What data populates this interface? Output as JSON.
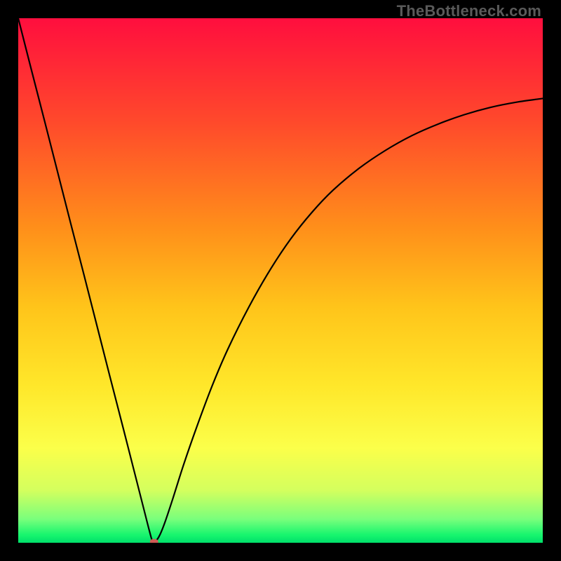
{
  "watermark": "TheBottleneck.com",
  "chart_data": {
    "type": "line",
    "title": "",
    "xlabel": "",
    "ylabel": "",
    "xlim": [
      0,
      100
    ],
    "ylim": [
      0,
      100
    ],
    "grid": false,
    "background_gradient": {
      "stops": [
        {
          "offset": 0.0,
          "color": "#ff0e3e"
        },
        {
          "offset": 0.2,
          "color": "#ff4a2b"
        },
        {
          "offset": 0.4,
          "color": "#ff8f1a"
        },
        {
          "offset": 0.55,
          "color": "#ffc41a"
        },
        {
          "offset": 0.7,
          "color": "#ffe72a"
        },
        {
          "offset": 0.82,
          "color": "#fbff4a"
        },
        {
          "offset": 0.9,
          "color": "#d4ff5e"
        },
        {
          "offset": 0.955,
          "color": "#79ff7c"
        },
        {
          "offset": 0.985,
          "color": "#17f56e"
        },
        {
          "offset": 1.0,
          "color": "#00e06a"
        }
      ]
    },
    "series": [
      {
        "name": "bottleneck-curve",
        "x": [
          0.0,
          2.5,
          5.0,
          7.5,
          10.0,
          12.5,
          15.0,
          17.5,
          20.0,
          22.5,
          24.0,
          25.0,
          25.6,
          26.2,
          27.0,
          28.0,
          29.5,
          31.5,
          34.0,
          37.0,
          40.0,
          44.0,
          48.0,
          52.0,
          56.0,
          60.0,
          65.0,
          70.0,
          75.0,
          80.0,
          85.0,
          90.0,
          95.0,
          100.0
        ],
        "y": [
          100.0,
          90.2,
          80.5,
          70.7,
          60.9,
          51.2,
          41.4,
          31.6,
          21.9,
          12.1,
          6.2,
          2.3,
          0.3,
          0.3,
          1.5,
          4.0,
          8.5,
          14.8,
          22.0,
          30.0,
          37.0,
          45.0,
          52.0,
          58.0,
          63.0,
          67.2,
          71.4,
          74.8,
          77.6,
          79.8,
          81.6,
          83.0,
          84.0,
          84.7
        ]
      }
    ],
    "marker": {
      "name": "optimal-point",
      "x": 25.9,
      "y": 0.2,
      "color": "#cf5b55",
      "rx": 6,
      "ry": 4
    }
  }
}
